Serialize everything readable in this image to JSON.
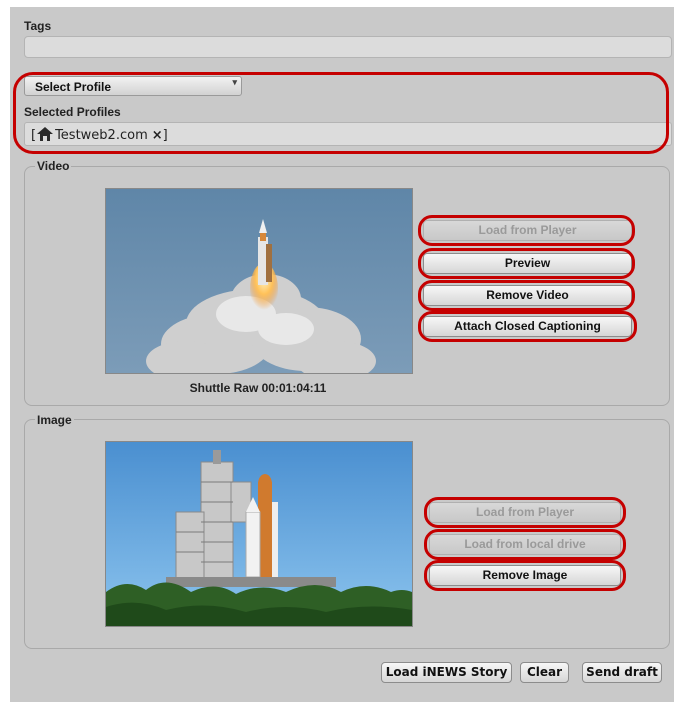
{
  "tags": {
    "label": "Tags",
    "value": ""
  },
  "profile": {
    "select_label": "Select Profile",
    "selected_label": "Selected Profiles",
    "selected_open": "[",
    "selected_item": "Testweb2.com",
    "selected_remove": "×",
    "selected_close": "]"
  },
  "video": {
    "legend": "Video",
    "caption": "Shuttle Raw 00:01:04:11",
    "buttons": {
      "load_from_player": "Load from Player",
      "preview": "Preview",
      "remove_video": "Remove Video",
      "attach_cc": "Attach Closed Captioning"
    }
  },
  "image": {
    "legend": "Image",
    "buttons": {
      "load_from_player": "Load from Player",
      "load_from_local": "Load from local drive",
      "remove_image": "Remove Image"
    }
  },
  "footer": {
    "load_inews": "Load iNEWS Story",
    "clear": "Clear",
    "send_draft": "Send draft"
  },
  "colors": {
    "panel_bg": "#c9c9c9",
    "highlight": "#c50000",
    "disabled_text": "#9a9a9a"
  }
}
